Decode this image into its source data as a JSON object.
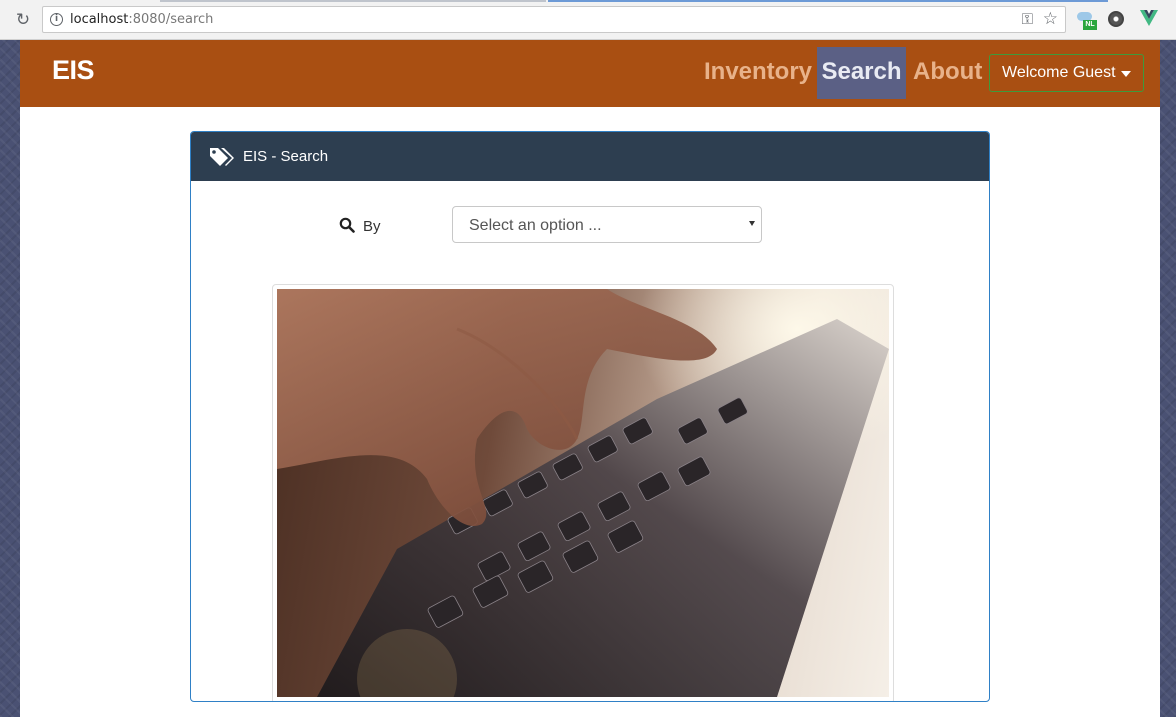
{
  "browser": {
    "url_host": "localhost",
    "url_rest": ":8080/search"
  },
  "navbar": {
    "brand": "EIS",
    "links": [
      "Inventory",
      "Search",
      "About"
    ],
    "user_menu": "Welcome Guest",
    "colors": {
      "bar": "#a94f12",
      "active_link_bg": "#5b6085",
      "link": "#e8b28a"
    }
  },
  "card": {
    "title": "EIS - Search",
    "search_label": "By",
    "select_placeholder": "Select an option ...",
    "colors": {
      "header": "#2d3e50",
      "border": "#2f80c6"
    }
  },
  "icons": [
    "reload-icon",
    "info-icon",
    "key-icon",
    "star-icon",
    "tags-icon",
    "search-icon"
  ]
}
